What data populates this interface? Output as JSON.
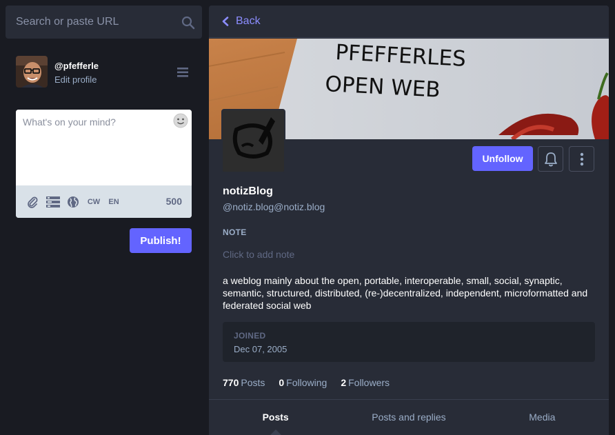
{
  "search": {
    "placeholder": "Search or paste URL"
  },
  "account": {
    "handle": "@pfefferle",
    "edit_label": "Edit profile"
  },
  "compose": {
    "placeholder": "What's on your mind?",
    "cw_label": "CW",
    "language_label": "EN",
    "char_count": "500",
    "publish_label": "Publish!"
  },
  "profile": {
    "back_label": "Back",
    "header_text_line1": "PFEFFERLES",
    "header_text_line2": "OPEN WEB",
    "unfollow_label": "Unfollow",
    "display_name": "notizBlog",
    "acct": "@notiz.blog@notiz.blog",
    "note_label": "NOTE",
    "note_placeholder": "Click to add note",
    "bio": "a weblog mainly about the open, portable, interoperable, small, social, synaptic, semantic, structured, distributed, (re-)decentralized, independent, microformatted and federated social web",
    "joined_label": "JOINED",
    "joined_date": "Dec 07, 2005",
    "counts": {
      "posts_num": "770",
      "posts_label": "Posts",
      "following_num": "0",
      "following_label": "Following",
      "followers_num": "2",
      "followers_label": "Followers"
    },
    "tabs": [
      {
        "label": "Posts"
      },
      {
        "label": "Posts and replies"
      },
      {
        "label": "Media"
      }
    ]
  },
  "colors": {
    "accent": "#6364ff",
    "background": "#191b22",
    "panel": "#282c37",
    "secondary_text": "#9baec8"
  },
  "icons": [
    "search-icon",
    "menu-icon",
    "emoji-icon",
    "attach-icon",
    "poll-icon",
    "globe-icon",
    "chevron-left-icon",
    "bell-icon",
    "more-vertical-icon"
  ]
}
